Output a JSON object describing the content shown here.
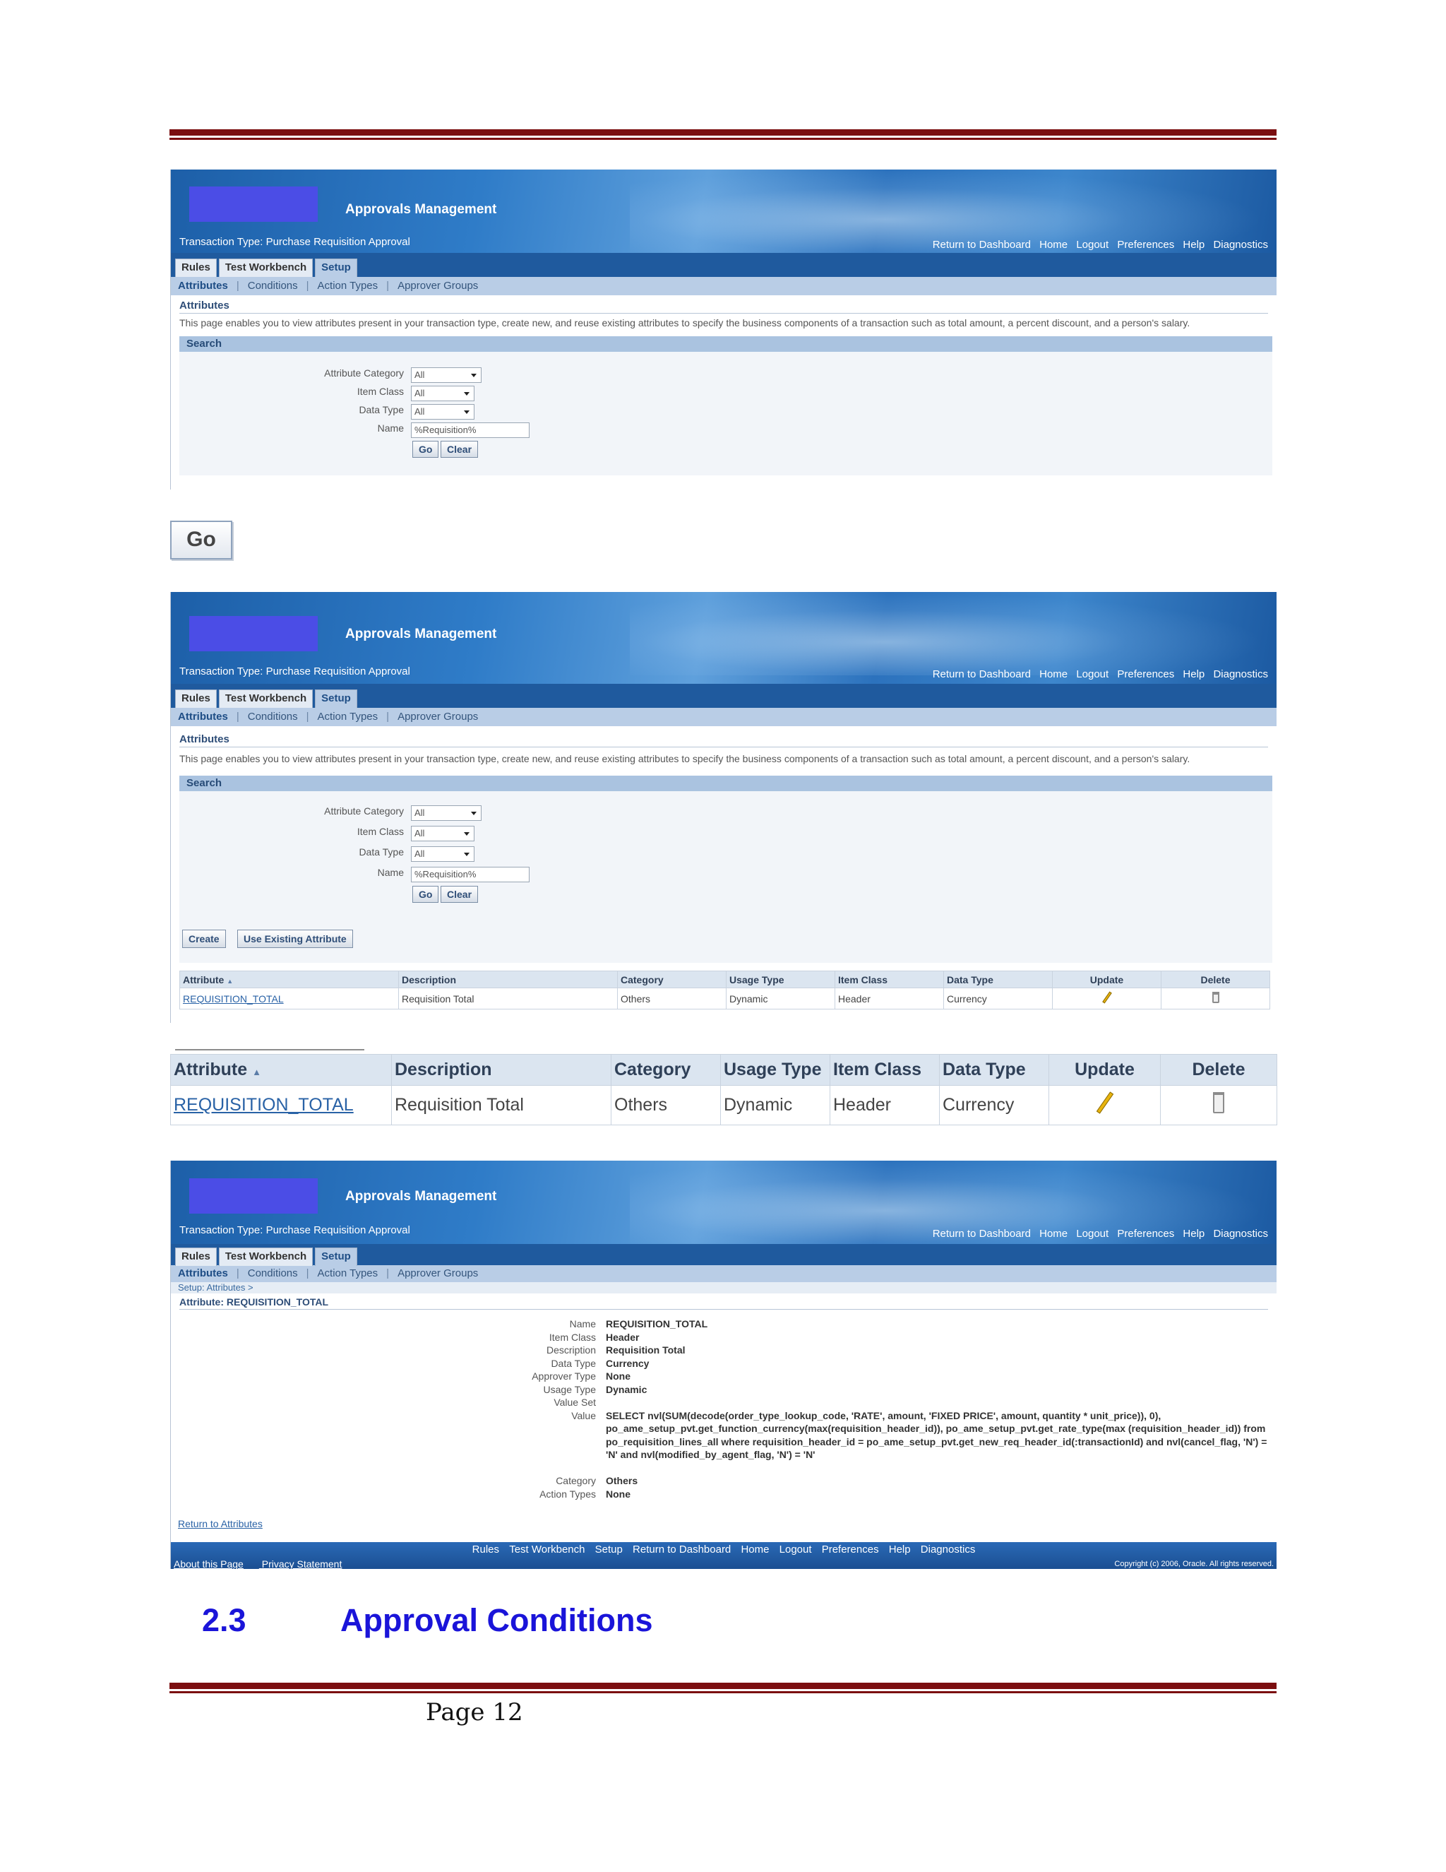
{
  "app": {
    "title": "Approvals Management",
    "transaction_type": "Transaction Type: Purchase Requisition Approval",
    "global_links": [
      "Return to Dashboard",
      "Home",
      "Logout",
      "Preferences",
      "Help",
      "Diagnostics"
    ],
    "tabs": [
      "Rules",
      "Test Workbench",
      "Setup"
    ],
    "active_tab": "Setup",
    "subtabs": [
      "Attributes",
      "Conditions",
      "Action Types",
      "Approver Groups"
    ],
    "active_subtab": "Attributes"
  },
  "attributes_page": {
    "title": "Attributes",
    "description": "This page enables you to view attributes present in your transaction type, create new, and reuse existing attributes to specify the business components of a transaction such as total amount, a percent discount, and a person's salary.",
    "search": {
      "header": "Search",
      "fields": [
        {
          "label": "Attribute Category",
          "value": "All"
        },
        {
          "label": "Item Class",
          "value": "All"
        },
        {
          "label": "Data Type",
          "value": "All"
        },
        {
          "label": "Name",
          "value": "%Requisition%"
        }
      ],
      "go_label": "Go",
      "clear_label": "Clear"
    },
    "actions": {
      "create": "Create",
      "use_existing": "Use Existing Attribute"
    }
  },
  "go_button_zoom": "Go",
  "results_table": {
    "columns": [
      "Attribute",
      "Description",
      "Category",
      "Usage Type",
      "Item Class",
      "Data Type",
      "Update",
      "Delete"
    ],
    "sort_indicator": "▲",
    "rows": [
      {
        "attribute": "REQUISITION_TOTAL",
        "description": "Requisition Total",
        "category": "Others",
        "usage_type": "Dynamic",
        "item_class": "Header",
        "data_type": "Currency"
      }
    ]
  },
  "detail_page": {
    "breadcrumb": "Setup: Attributes  >",
    "title": "Attribute: REQUISITION_TOTAL",
    "fields": [
      {
        "label": "Name",
        "value": "REQUISITION_TOTAL"
      },
      {
        "label": "Item Class",
        "value": "Header"
      },
      {
        "label": "Description",
        "value": "Requisition Total"
      },
      {
        "label": "Data Type",
        "value": "Currency"
      },
      {
        "label": "Approver Type",
        "value": "None"
      },
      {
        "label": "Usage Type",
        "value": "Dynamic"
      },
      {
        "label": "Value Set",
        "value": ""
      },
      {
        "label": "Value",
        "value": "SELECT nvl(SUM(decode(order_type_lookup_code, 'RATE', amount, 'FIXED PRICE', amount, quantity * unit_price)), 0), po_ame_setup_pvt.get_function_currency(max(requisition_header_id)), po_ame_setup_pvt.get_rate_type(max (requisition_header_id)) from po_requisition_lines_all where requisition_header_id = po_ame_setup_pvt.get_new_req_header_id(:transactionId) and nvl(cancel_flag, 'N') = 'N' and nvl(modified_by_agent_flag, 'N') = 'N'"
      },
      {
        "label": "Category",
        "value": "Others"
      },
      {
        "label": "Action Types",
        "value": "None"
      }
    ],
    "return_link": "Return to Attributes",
    "footer_links": [
      "Rules",
      "Test Workbench",
      "Setup",
      "Return to Dashboard",
      "Home",
      "Logout",
      "Preferences",
      "Help",
      "Diagnostics"
    ],
    "footer_bottom_links": [
      "About this Page",
      "Privacy Statement"
    ],
    "copyright": "Copyright (c) 2006, Oracle. All rights reserved."
  },
  "section": {
    "number": "2.3",
    "title": "Approval Conditions"
  },
  "page_label": "Page 12",
  "colors": {
    "rule": "#7b0e10",
    "heading": "#1a14d9",
    "banner": "#2f7cc8",
    "tabbar": "#1f5a9e"
  }
}
